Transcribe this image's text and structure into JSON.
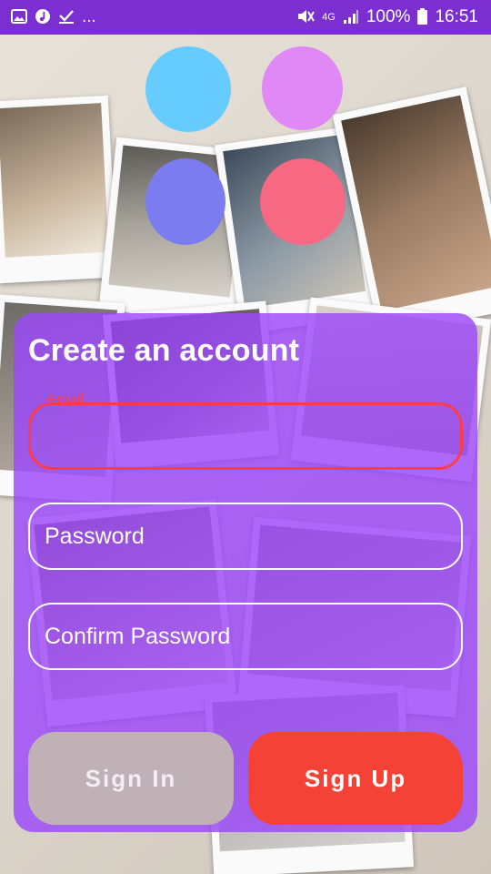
{
  "status_bar": {
    "left_icons": [
      "image-icon",
      "music-icon",
      "check-icon"
    ],
    "ellipsis": "...",
    "network": "4G",
    "battery": "100%",
    "time": "16:51"
  },
  "colors": {
    "status_bar": "#7b2fd0",
    "card": "#9c48fa",
    "error": "#ff3b46",
    "sign_in_button": "#bfb1b5",
    "sign_up_button": "#f44336",
    "circle_blue": "#66ccff",
    "circle_pink": "#e088f5",
    "circle_periwinkle": "#7b7cf0",
    "circle_red": "#f76882"
  },
  "form": {
    "title": "Create an account",
    "email": {
      "label": "Email",
      "value": ""
    },
    "password": {
      "placeholder": "Password"
    },
    "confirm_password": {
      "placeholder": "Confirm Password"
    }
  },
  "buttons": {
    "sign_in": "Sign In",
    "sign_up": "Sign Up"
  }
}
